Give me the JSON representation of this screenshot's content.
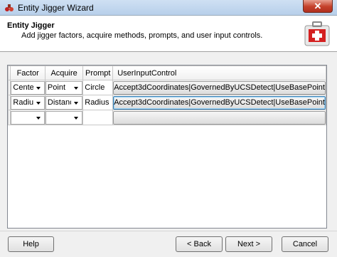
{
  "window": {
    "title": "Entity Jigger Wizard",
    "close_glyph": "✕"
  },
  "header": {
    "title": "Entity Jigger",
    "subtitle": "Add jigger factors, acquire methods, prompts, and user input controls."
  },
  "grid": {
    "columns": [
      "Factor",
      "Acquire",
      "Prompt",
      "UserInputControl"
    ],
    "rows": [
      {
        "factor": "Center",
        "acquire": "Point",
        "prompt": "Circle",
        "control": "Accept3dCoordinates|GovernedByUCSDetect|UseBasePoint"
      },
      {
        "factor": "Radius",
        "acquire": "Distance",
        "prompt": "Radius",
        "control": "Accept3dCoordinates|GovernedByUCSDetect|UseBasePoint"
      },
      {
        "factor": "",
        "acquire": "",
        "prompt": "",
        "control": ""
      }
    ]
  },
  "buttons": {
    "help": "Help",
    "back": "< Back",
    "next": "Next >",
    "cancel": "Cancel"
  },
  "icons": {
    "app": "wizard-app-icon",
    "header": "first-aid-kit-icon"
  },
  "colors": {
    "close": "#c4402a",
    "header_icon_red": "#d42020"
  }
}
